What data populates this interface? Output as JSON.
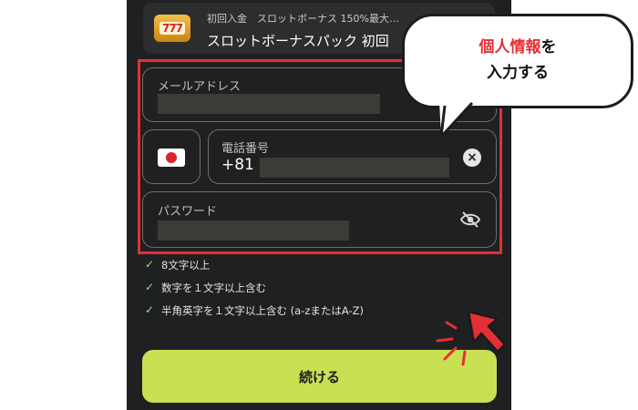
{
  "promo": {
    "icon_text": "777",
    "subtitle": "初回入金　スロットボーナス 150%最大…",
    "title": "スロットボーナスパック 初回"
  },
  "form": {
    "email_label": "メールアドレス",
    "phone_label": "電話番号",
    "phone_prefix": "+81",
    "password_label": "パスワード",
    "country_flag": "japan-flag"
  },
  "requirements": [
    "8文字以上",
    "数字を１文字以上含む",
    "半角英字を１文字以上含む (a-zまたはA-Z)"
  ],
  "continue_label": "続ける",
  "callout": {
    "line1_red": "個人情報",
    "line1_rest": "を",
    "line2": "入力する"
  },
  "colors": {
    "accent_red": "#e52f35",
    "button_green": "#c9e052",
    "check_green": "#9ee066",
    "panel_dark": "#1f2021"
  }
}
